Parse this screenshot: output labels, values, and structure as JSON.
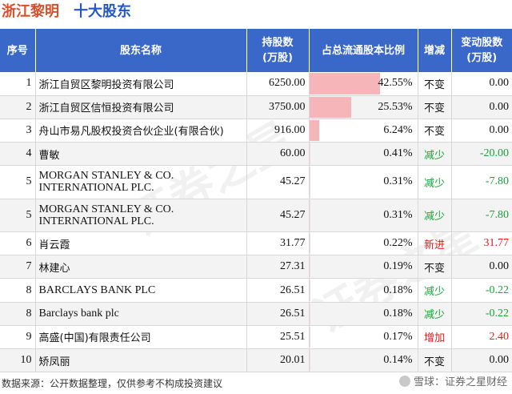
{
  "title": {
    "company": "浙江黎明",
    "section": "十大股东"
  },
  "header": {
    "idx": "序号",
    "name": "股东名称",
    "shares_line1": "持股数",
    "shares_line2": "(万股)",
    "ratio": "占总流通股本比例",
    "change": "增减",
    "delta_line1": "变动股数",
    "delta_line2": "(万股)"
  },
  "rows": [
    {
      "idx": "1",
      "name": "浙江自贸区黎明投资有限公司",
      "shares": "6250.00",
      "ratio": "42.55%",
      "ratio_value": 42.55,
      "change": "不变",
      "change_type": "same",
      "delta": "0.00"
    },
    {
      "idx": "2",
      "name": "浙江自贸区信恒投资有限公司",
      "shares": "3750.00",
      "ratio": "25.53%",
      "ratio_value": 25.53,
      "change": "不变",
      "change_type": "same",
      "delta": "0.00"
    },
    {
      "idx": "3",
      "name": "舟山市易凡股权投资合伙企业(有限合伙)",
      "shares": "916.00",
      "ratio": "6.24%",
      "ratio_value": 6.24,
      "change": "不变",
      "change_type": "same",
      "delta": "0.00"
    },
    {
      "idx": "4",
      "name": "曹敏",
      "shares": "60.00",
      "ratio": "0.41%",
      "ratio_value": 0.41,
      "change": "减少",
      "change_type": "down",
      "delta": "-20.00"
    },
    {
      "idx": "5",
      "name": "MORGAN STANLEY & CO. INTERNATIONAL PLC.",
      "shares": "45.27",
      "ratio": "0.31%",
      "ratio_value": 0.31,
      "change": "减少",
      "change_type": "down",
      "delta": "-7.80",
      "english": true
    },
    {
      "idx": "5",
      "name": "MORGAN STANLEY & CO. INTERNATIONAL PLC.",
      "shares": "45.27",
      "ratio": "0.31%",
      "ratio_value": 0.31,
      "change": "减少",
      "change_type": "down",
      "delta": "-7.80",
      "english": true
    },
    {
      "idx": "6",
      "name": "肖云霞",
      "shares": "31.77",
      "ratio": "0.22%",
      "ratio_value": 0.22,
      "change": "新进",
      "change_type": "up",
      "delta": "31.77"
    },
    {
      "idx": "7",
      "name": "林建心",
      "shares": "27.31",
      "ratio": "0.19%",
      "ratio_value": 0.19,
      "change": "不变",
      "change_type": "same",
      "delta": "0.00"
    },
    {
      "idx": "8",
      "name": "BARCLAYS BANK PLC",
      "shares": "26.51",
      "ratio": "0.18%",
      "ratio_value": 0.18,
      "change": "减少",
      "change_type": "down",
      "delta": "-0.22",
      "english": true
    },
    {
      "idx": "8",
      "name": "Barclays bank plc",
      "shares": "26.51",
      "ratio": "0.18%",
      "ratio_value": 0.18,
      "change": "减少",
      "change_type": "down",
      "delta": "-0.22",
      "english": true
    },
    {
      "idx": "9",
      "name": "高盛(中国)有限责任公司",
      "shares": "25.51",
      "ratio": "0.17%",
      "ratio_value": 0.17,
      "change": "增加",
      "change_type": "up",
      "delta": "2.40"
    },
    {
      "idx": "10",
      "name": "矫凤丽",
      "shares": "20.01",
      "ratio": "0.14%",
      "ratio_value": 0.14,
      "change": "不变",
      "change_type": "same",
      "delta": "0.00"
    }
  ],
  "footer": {
    "source": "数据来源：公开数据整理，仅供参考不构成投资建议",
    "brand": "雪球：证券之星财经"
  },
  "watermark": {
    "text": "证券之星"
  },
  "colors": {
    "header_bg": "#3a68c9",
    "bar": "#f6b5b8",
    "up": "#e21b1b",
    "down": "#19a23a",
    "title_company": "#d94f2a",
    "title_section": "#2457c5"
  }
}
